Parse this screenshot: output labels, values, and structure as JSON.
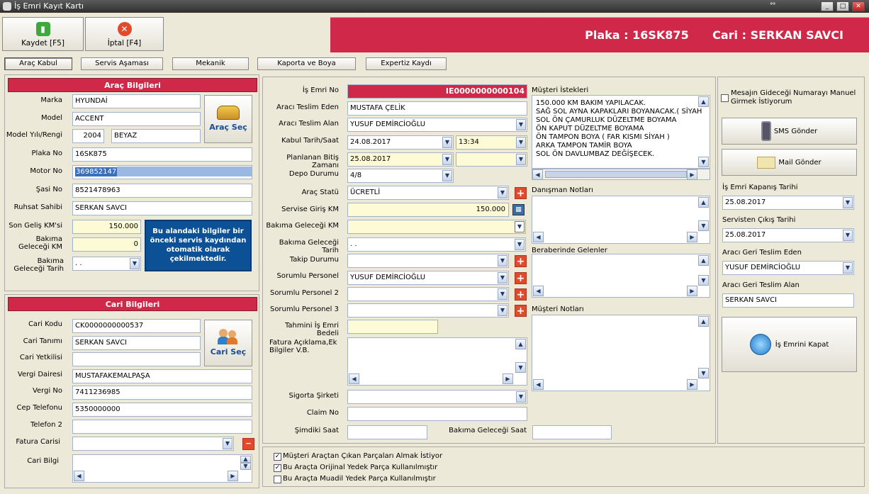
{
  "window": {
    "title": "İş Emri Kayıt Kartı"
  },
  "toolbar": {
    "save_label": "Kaydet [F5]",
    "cancel_label": "İptal [F4]"
  },
  "header": {
    "plate": "Plaka : 16SK875",
    "customer": "Cari : SERKAN SAVCI"
  },
  "tabs": [
    "Araç Kabul",
    "Servis Aşaması",
    "Mekanik",
    "Kaporta ve Boya",
    "Expertiz Kaydı"
  ],
  "arac": {
    "title": "Araç Bilgileri",
    "marka_l": "Marka",
    "marka": "HYUNDAİ",
    "model_l": "Model",
    "model": "ACCENT",
    "yil_l": "Model Yılı/Rengi",
    "yil": "2004",
    "renk": "BEYAZ",
    "plaka_l": "Plaka No",
    "plaka": "16SK875",
    "motor_l": "Motor No",
    "motor": "369852147",
    "sasi_l": "Şasi No",
    "sasi": "8521478963",
    "ruhsat_l": "Ruhsat Sahibi",
    "ruhsat": "SERKAN SAVCI",
    "songelis_l": "Son Geliş KM'si",
    "songelis": "150.000",
    "bakimkm_l": "Bakıma Geleceği KM",
    "bakimkm": "0",
    "bakimtarih_l": "Bakıma Geleceği Tarih",
    "bakimtarih": ". .",
    "select_btn": "Araç Seç",
    "info": "Bu alandaki bilgiler bir önceki servis kaydından otomatik olarak çekilmektedir."
  },
  "cari": {
    "title": "Cari Bilgileri",
    "kod_l": "Cari Kodu",
    "kod": "CK0000000000537",
    "tanim_l": "Cari Tanımı",
    "tanim": "SERKAN SAVCI",
    "yetkili_l": "Cari Yetkilisi",
    "vd_l": "Vergi Dairesi",
    "vd": "MUSTAFAKEMALPAŞA",
    "vno_l": "Vergi No",
    "vno": "7411236985",
    "cep_l": "Cep Telefonu",
    "cep": "5350000000",
    "tel2_l": "Telefon 2",
    "fatura_l": "Fatura Carisi",
    "bilgi_l": "Cari Bilgi",
    "select_btn": "Cari Seç"
  },
  "is": {
    "no_l": "İş Emri No",
    "no": "IE0000000000104",
    "teslimeden_l": "Aracı Teslim Eden",
    "teslimeden": "MUSTAFA ÇELİK",
    "teslimalan_l": "Aracı Teslim Alan",
    "teslimalan": "YUSUF DEMİRCİOĞLU",
    "kabul_l": "Kabul Tarih/Saat",
    "kabul_tarih": "24.08.2017",
    "kabul_saat": "13:34",
    "bitis_l": "Planlanan Bitiş Zamanı",
    "bitis": "25.08.2017",
    "depo_l": "Depo Durumu",
    "depo": "4/8",
    "statu_l": "Araç Statü",
    "statu": "ÜCRETLİ",
    "giriskm_l": "Servise Giriş KM",
    "giriskm": "150.000",
    "bakimkm_l": "Bakıma Geleceği KM",
    "bakimtarih_l": "Bakıma Geleceği Tarih",
    "bakimtarih": ". .",
    "takip_l": "Takip Durumu",
    "personel_l": "Sorumlu Personel",
    "personel": "YUSUF DEMİRCİOĞLU",
    "personel2_l": "Sorumlu Personel 2",
    "personel3_l": "Sorumlu Personel 3",
    "bedel_l": "Tahmini İş Emri Bedeli",
    "fatura_l": "Fatura Açıklama,Ek Bilgiler V.B.",
    "sigorta_l": "Sigorta Şirketi",
    "claim_l": "Claim No",
    "simdiki_l": "Şimdiki Saat",
    "bakimsaat_l": "Bakıma Geleceği Saat"
  },
  "notes": {
    "istek_l": "Müşteri İstekleri",
    "istek": [
      "150.000 KM BAKIM YAPILACAK.",
      "SAĞ SOL AYNA KAPAKLARI BOYANACAK.( SİYAH",
      "SOL ÖN ÇAMURLUK DÜZELTME BOYAMA",
      "ÖN KAPUT DÜZELTME BOYAMA",
      "ÖN TAMPON BOYA ( FAR KISMI SİYAH )",
      "ARKA TAMPON TAMİR BOYA",
      "SOL ÖN DAVLUMBAZ DEĞİŞECEK."
    ],
    "danisman_l": "Danışman Notları",
    "beraber_l": "Beraberinde Gelenler",
    "musteri_l": "Müşteri Notları"
  },
  "right": {
    "manual_l": "Mesajın Gideceği Numarayı Manuel Girmek İstiyorum",
    "sms": "SMS Gönder",
    "mail": "Mail Gönder",
    "kapanis_l": "İş Emri Kapanış Tarihi",
    "kapanis": "25.08.2017",
    "cikis_l": "Servisten Çıkış Tarihi",
    "cikis": "25.08.2017",
    "geriteslimeden_l": "Aracı Geri Teslim Eden",
    "geriteslimeden": "YUSUF DEMİRCİOĞLU",
    "geriteslimalan_l": "Aracı Geri Teslim Alan",
    "geriteslimalan": "SERKAN SAVCI",
    "kapat": "İş Emrini Kapat"
  },
  "checks": [
    {
      "label": "Müşteri Araçtan Çıkan Parçaları Almak İstiyor",
      "checked": true
    },
    {
      "label": "Bu Araçta Orijinal Yedek Parça Kullanılmıştır",
      "checked": true
    },
    {
      "label": "Bu Araçta Muadil Yedek Parça Kullanılmıştır",
      "checked": false
    }
  ],
  "colors": {
    "accent": "#cf2848",
    "info": "#0c5196"
  }
}
